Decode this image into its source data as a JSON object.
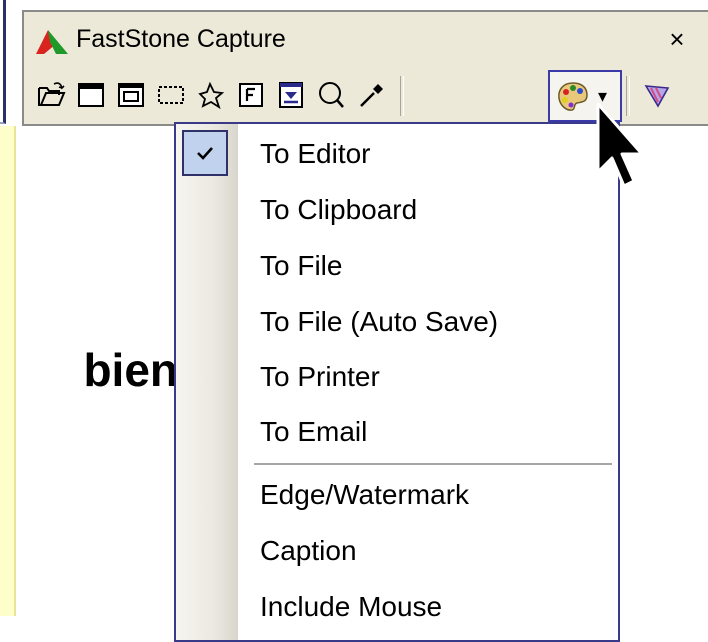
{
  "background": {
    "partial_word": "bien"
  },
  "window": {
    "title": "FastStone Capture",
    "close_label": "×"
  },
  "toolbar": {
    "items": [
      {
        "icon": "open-file-icon"
      },
      {
        "icon": "capture-window-icon"
      },
      {
        "icon": "capture-object-icon"
      },
      {
        "icon": "capture-rectangle-icon"
      },
      {
        "icon": "capture-freehand-icon"
      },
      {
        "icon": "capture-fullscreen-icon"
      },
      {
        "icon": "capture-scrolling-icon"
      },
      {
        "icon": "magnifier-icon"
      },
      {
        "icon": "color-picker-icon"
      },
      {
        "icon": "output-palette-icon"
      },
      {
        "icon": "settings-icon"
      }
    ],
    "output_caret": "▾"
  },
  "menu": {
    "items": [
      {
        "label": "To Editor",
        "checked": true
      },
      {
        "label": "To Clipboard",
        "checked": false
      },
      {
        "label": "To File",
        "checked": false
      },
      {
        "label": "To File (Auto Save)",
        "checked": false
      },
      {
        "label": "To Printer",
        "checked": false
      },
      {
        "label": "To Email",
        "checked": false
      },
      {
        "label": "Edge/Watermark",
        "checked": false
      },
      {
        "label": "Caption",
        "checked": false
      },
      {
        "label": "Include Mouse",
        "checked": false
      }
    ],
    "check_icon": "checkmark-icon"
  },
  "colors": {
    "menu_border": "#3a3a8a",
    "check_highlight": "#c1d2ee",
    "background_yellow": "#fefecb",
    "toolbar_bg": "#ece9d8"
  }
}
